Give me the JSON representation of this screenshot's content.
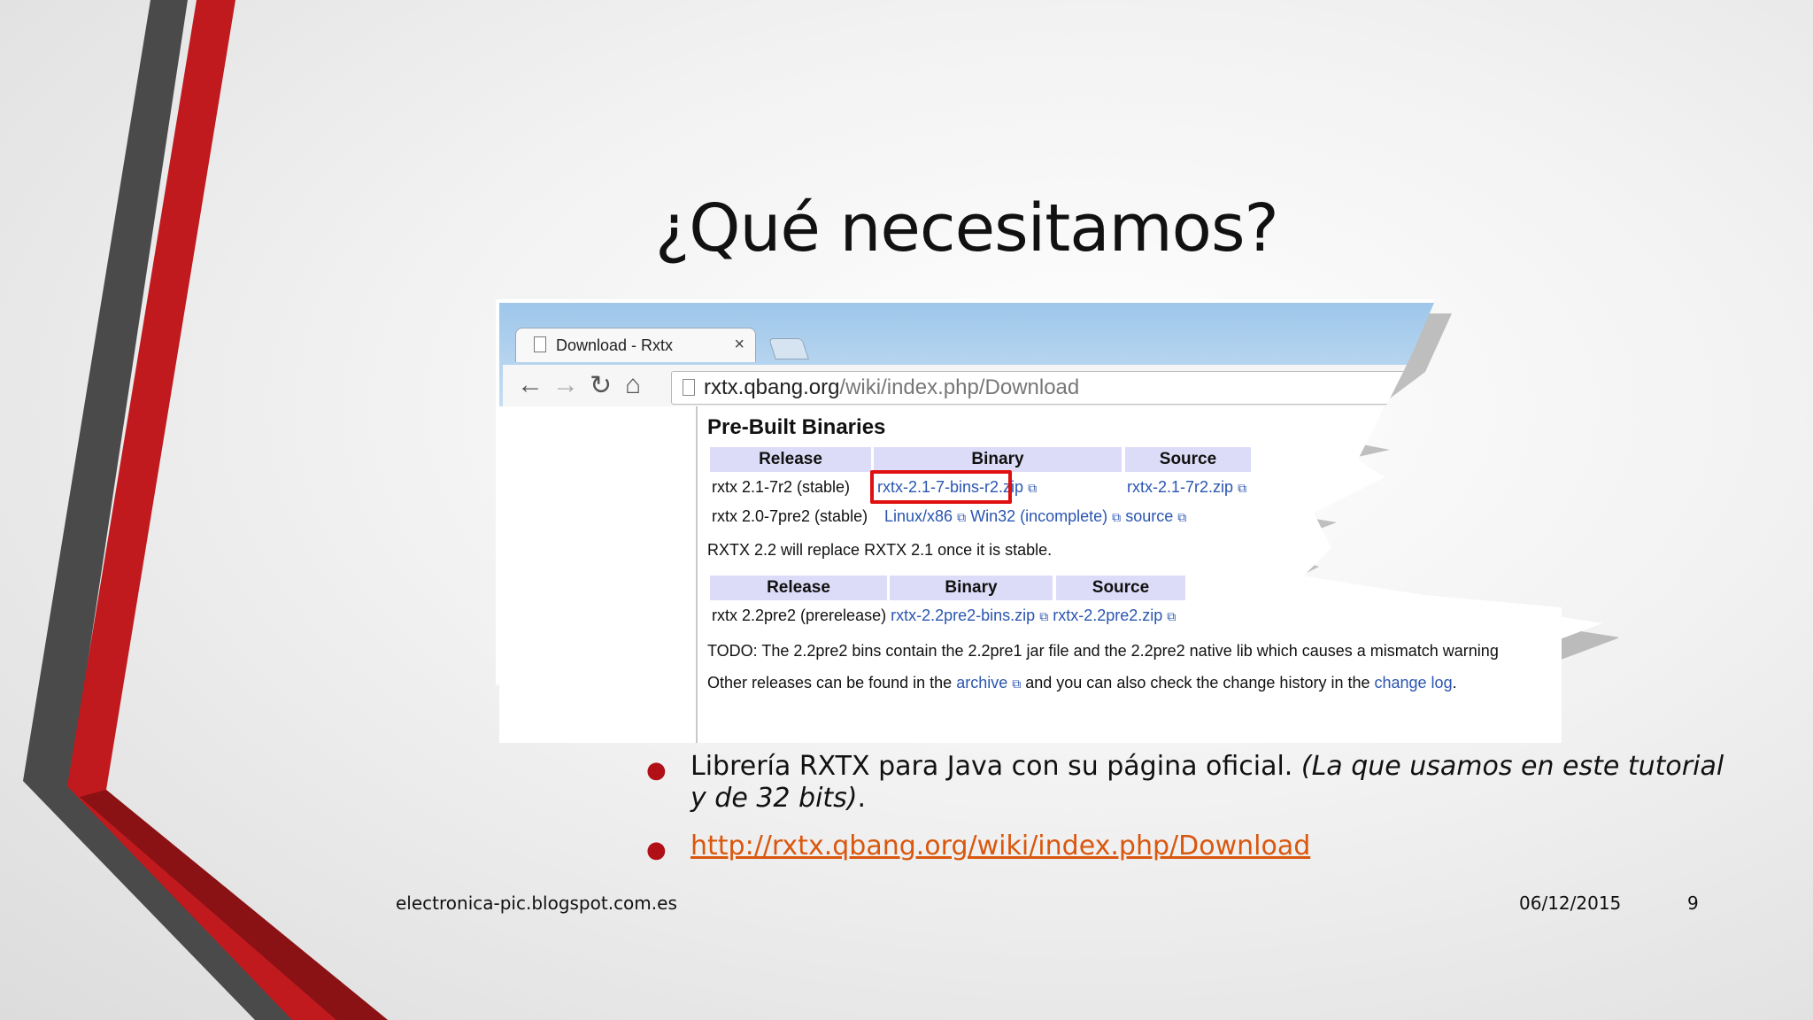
{
  "slide": {
    "title": "¿Qué necesitamos?",
    "footer_left": "electronica-pic.blogspot.com.es",
    "footer_date": "06/12/2015",
    "page_number": "9"
  },
  "browser": {
    "tab_title": "Download - Rxtx",
    "tab_close": "×",
    "url_host": "rxtx.qbang.org",
    "url_path": "/wiki/index.php/Download",
    "icons": {
      "back": "back-arrow-icon",
      "forward": "forward-arrow-icon",
      "reload": "reload-icon",
      "home": "home-icon",
      "page": "document-icon",
      "external": "external-link-icon"
    }
  },
  "webpage": {
    "heading": "Pre-Built Binaries",
    "table1": {
      "headers": [
        "Release",
        "Binary",
        "Source"
      ],
      "rows": [
        {
          "release": "rxtx 2.1-7r2 (stable)",
          "binary": "rxtx-2.1-7-bins-r2.zip",
          "source": "rxtx-2.1-7r2.zip"
        },
        {
          "release": "rxtx 2.0-7pre2 (stable)",
          "binary1": "Linux/x86",
          "binary2": "Win32 (incomplete)",
          "source": "source"
        }
      ]
    },
    "note1": "RXTX 2.2 will replace RXTX 2.1 once it is stable.",
    "table2": {
      "headers": [
        "Release",
        "Binary",
        "Source"
      ],
      "rows": [
        {
          "release": "rxtx 2.2pre2 (prerelease)",
          "binary": "rxtx-2.2pre2-bins.zip",
          "source": "rxtx-2.2pre2.zip"
        }
      ]
    },
    "todo": "TODO: The 2.2pre2 bins contain the 2.2pre1 jar file and the 2.2pre2 native lib which causes a mismatch warning",
    "other_pre": "Other releases can be found in the ",
    "archive_link": "archive",
    "other_mid": " and you can also check the change history in the ",
    "changelog_link": "change log",
    "other_post": ".",
    "highlight_color": "#e01010"
  },
  "bullets": {
    "item1_text": "Librería RXTX para Java con su página oficial. ",
    "item1_italic": "(La que usamos en este tutorial y de 32 bits)",
    "item1_end": ".",
    "item2_link": "http://rxtx.qbang.org/wiki/index.php/Download",
    "bullet_color": "#b01016",
    "link_color": "#d9570e"
  }
}
